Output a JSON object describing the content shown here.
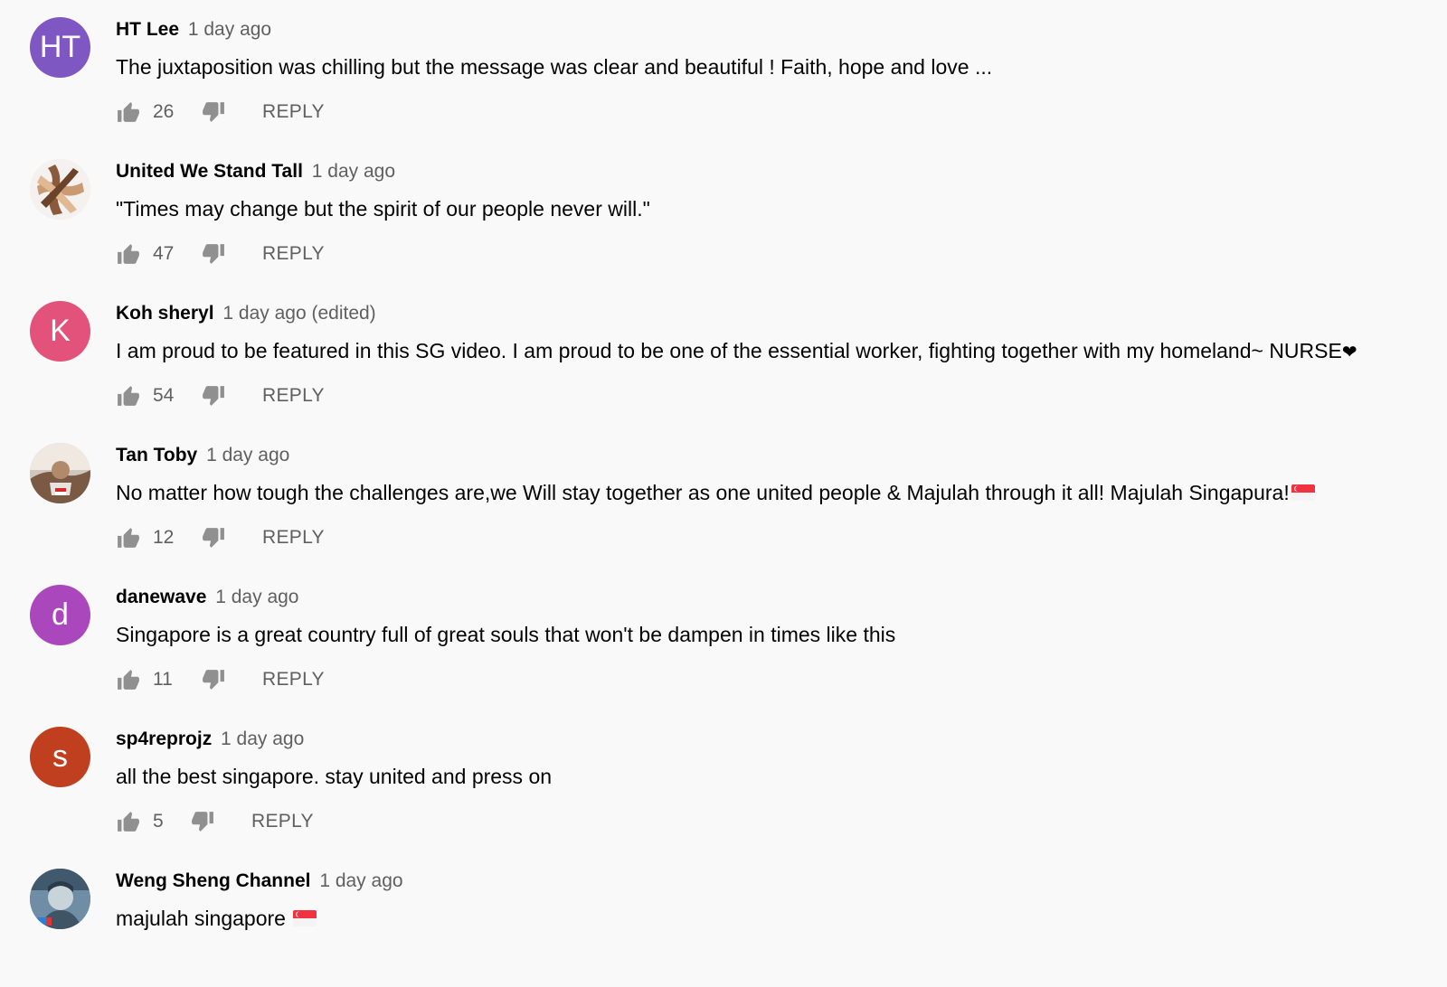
{
  "comments": [
    {
      "author": "HT Lee",
      "time": "1 day ago",
      "edited": "",
      "text": "The juxtaposition was chilling but the message was clear and beautiful ! Faith, hope and love ...",
      "likes": "26",
      "reply_label": "REPLY",
      "avatar": {
        "type": "initials",
        "initials": "HT",
        "color": "#7e57c2"
      }
    },
    {
      "author": "United We Stand Tall",
      "time": "1 day ago",
      "edited": "",
      "text": "\"Times may change but the spirit of our people never will.\"",
      "likes": "47",
      "reply_label": "REPLY",
      "avatar": {
        "type": "image",
        "icon": "joined-hands-photo"
      }
    },
    {
      "author": "Koh sheryl",
      "time": "1 day ago",
      "edited": "(edited)",
      "text": "I am proud to be featured in this SG video. I am proud to be one of the essential worker, fighting together with my homeland~ NURSE",
      "text_suffix": "❤",
      "likes": "54",
      "reply_label": "REPLY",
      "avatar": {
        "type": "initials",
        "initials": "K",
        "color": "#e2527a"
      }
    },
    {
      "author": "Tan Toby",
      "time": "1 day ago",
      "edited": "",
      "text": "No matter how tough the challenges are,we Will stay together as one united people & Majulah through it all! Majulah Singapura!",
      "flag": "singapore-flag",
      "likes": "12",
      "reply_label": "REPLY",
      "avatar": {
        "type": "image",
        "icon": "profile-photo"
      }
    },
    {
      "author": "danewave",
      "time": "1 day ago",
      "edited": "",
      "text": "Singapore is a great country full of great souls that won't be dampen in times like this",
      "likes": "11",
      "reply_label": "REPLY",
      "avatar": {
        "type": "initials",
        "initials": "d",
        "color": "#ab47bc"
      }
    },
    {
      "author": "sp4reprojz",
      "time": "1 day ago",
      "edited": "",
      "text": "all the best singapore. stay united and press on",
      "likes": "5",
      "reply_label": "REPLY",
      "avatar": {
        "type": "initials",
        "initials": "s",
        "color": "#bf3f1f"
      }
    },
    {
      "author": "Weng Sheng Channel",
      "time": "1 day ago",
      "edited": "",
      "text": "majulah singapore",
      "flag": "singapore-flag",
      "likes": "",
      "reply_label": "",
      "avatar": {
        "type": "image",
        "icon": "profile-photo"
      }
    }
  ],
  "colors": {
    "background": "#f9f9f9",
    "author": "#030303",
    "meta": "#606060",
    "text": "#030303"
  }
}
